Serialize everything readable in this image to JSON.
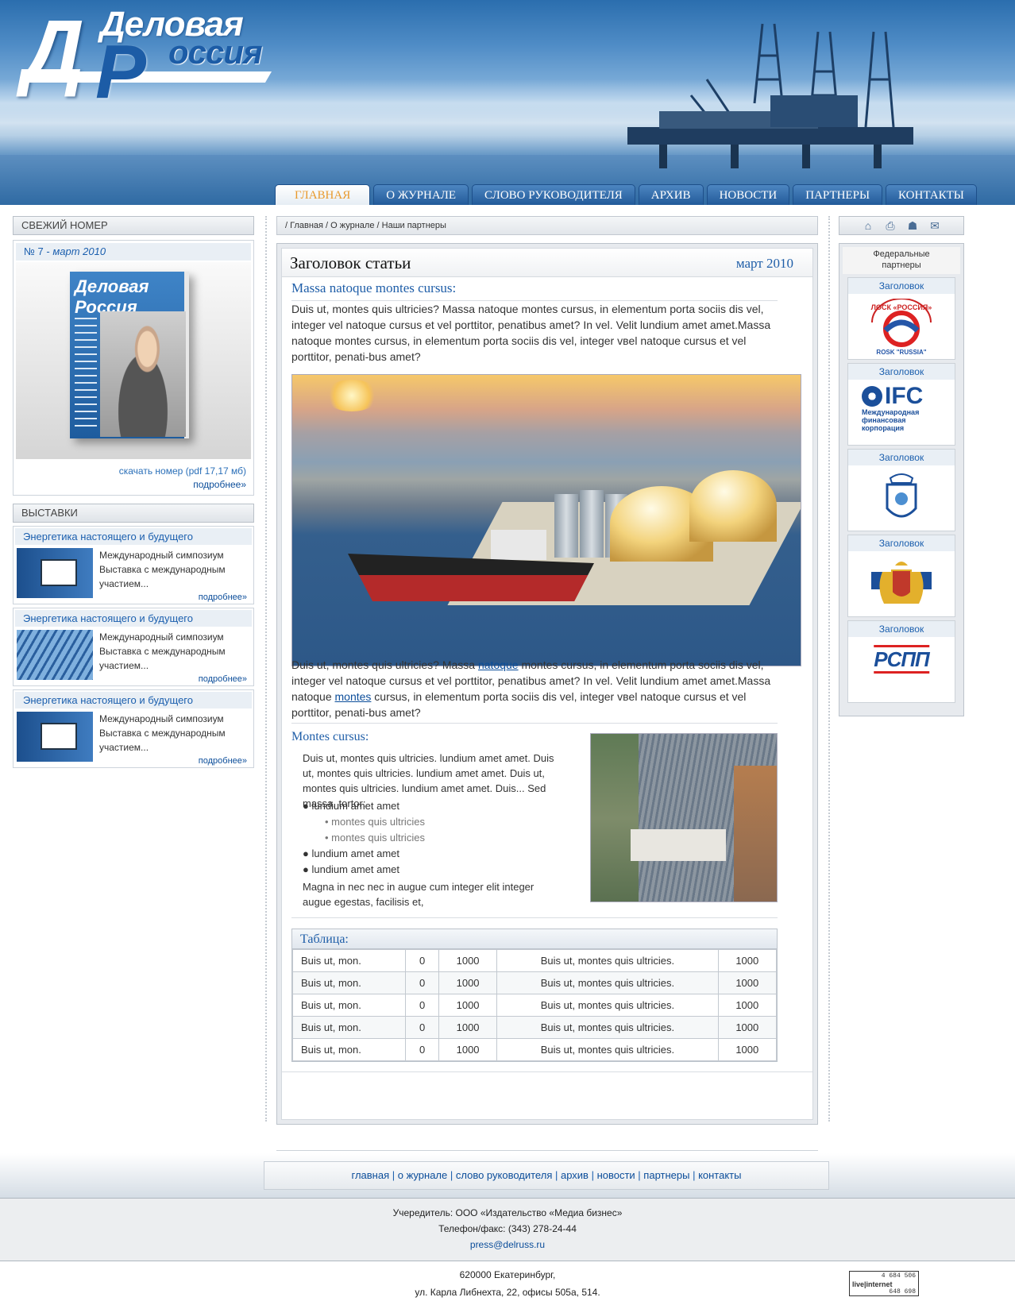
{
  "header": {
    "logo_line1": "Деловая",
    "logo_line2": "оссия",
    "logo_letter_d": "Д",
    "logo_letter_r": "Р"
  },
  "nav": {
    "tabs": [
      "ГЛАВНАЯ",
      "О ЖУРНАЛЕ",
      "СЛОВО РУКОВОДИТЕЛЯ",
      "АРХИВ",
      "НОВОСТИ",
      "ПАРТНЕРЫ",
      "КОНТАКТЫ"
    ],
    "active_index": 0
  },
  "left": {
    "issue_head": "СВЕЖИЙ НОМЕР",
    "issue_num": "№ 7 -",
    "issue_date": "март 2010",
    "cover_title": "Деловая Россия",
    "download": "скачать номер (pdf 17,17 мб)",
    "more": "подробнее»",
    "expo_head": "ВЫСТАВКИ",
    "expos": [
      {
        "title": "Энергетика настоящего и будущего",
        "line1": "Международный симпозиум",
        "line2": "Выставка с международным",
        "line3": "участием...",
        "more": "подробнее»",
        "thumb": "billboard"
      },
      {
        "title": "Энергетика настоящего и будущего",
        "line1": "Международный симпозиум",
        "line2": "Выставка с международным",
        "line3": "участием...",
        "more": "подробнее»",
        "thumb": "glass-building"
      },
      {
        "title": "Энергетика настоящего и будущего",
        "line1": "Международный симпозиум",
        "line2": "Выставка с международным",
        "line3": "участием...",
        "more": "подробнее»",
        "thumb": "billboard"
      }
    ]
  },
  "breadcrumb": "/ Главная / О журнале / Наши партнеры",
  "article": {
    "title": "Заголовок статьи",
    "date": "март 2010",
    "h1": "Massa natoque montes cursus:",
    "p1": "Duis ut, montes quis ultricies? Massa natoque montes cursus, in elementum porta sociis dis vel, integer vel natoque cursus et vel porttitor, penatibus amet? In vel. Velit lundium amet amet.Massa natoque montes cursus, in elementum porta sociis  dis vel, integer     vвel natoque cursus et vel porttitor, penati-bus amet?",
    "p2_a": "Duis ut, montes quis ultricies? Massa ",
    "p2_link1": "natoque",
    "p2_b": " montes cursus, in elementum porta sociis dis vel, integer vel natoque cursus et vel porttitor, penatibus amet? In vel. Velit lundium amet amet.Massa natoque ",
    "p2_link2": "montes",
    "p2_c": " cursus, in elementum porta sociis  dis vel, integer  vвel natoque cursus et vel porttitor, penati-bus amet?",
    "h2": "Montes cursus:",
    "p3": "Duis ut, montes quis ultricies. lundium amet amet. Duis ut, montes quis ultricies. lundium amet amet. Duis ut, montes quis ultricies. lundium amet amet. Duis... Sed massa, tortor:",
    "list": [
      "lundium amet amet",
      "montes quis ultricies",
      "montes quis ultricies",
      "lundium amet amet",
      "lundium amet amet"
    ],
    "p4": "Magna in nec nec in augue cum integer elit integer augue egestas, facilisis et,",
    "table_caption": "Таблица:",
    "table_rows": [
      [
        "Buis ut, mon.",
        "0",
        "1000",
        "Buis ut, montes quis ultricies.",
        "1000"
      ],
      [
        "Buis ut, mon.",
        "0",
        "1000",
        "Buis ut, montes quis ultricies.",
        "1000"
      ],
      [
        "Buis ut, mon.",
        "0",
        "1000",
        "Buis ut, montes quis ultricies.",
        "1000"
      ],
      [
        "Buis ut, mon.",
        "0",
        "1000",
        "Buis ut, montes quis ultricies.",
        "1000"
      ],
      [
        "Buis ut, mon.",
        "0",
        "1000",
        "Buis ut, montes quis ultricies.",
        "1000"
      ]
    ]
  },
  "right": {
    "tools": [
      "home-icon",
      "print-icon",
      "sitemap-icon",
      "mail-icon"
    ],
    "partners_title_1": "Федеральные",
    "partners_title_2": "партнеры",
    "partners": [
      {
        "title": "Заголовок",
        "logo_text": "ЛОСК «РОССИЯ»"
      },
      {
        "title": "Заголовок",
        "logo_text": "IFC",
        "logo_sub": "Международная финансовая корпорация"
      },
      {
        "title": "Заголовок",
        "logo_text": ""
      },
      {
        "title": "Заголовок",
        "logo_text": ""
      },
      {
        "title": "Заголовок",
        "logo_text": "РСПП"
      }
    ]
  },
  "footer": {
    "links": [
      "главная",
      "о журнале",
      "слово руководителя",
      "архив",
      "новости",
      "партнеры",
      "контакты"
    ],
    "founder": "Учередитель: ООО «Издательство «Медиа бизнес»",
    "phone": "Телефон/факс: (343) 278-24-44",
    "email": "press@delruss.ru",
    "addr1": "620000 Екатеринбург,",
    "addr2": "ул. Карла Либнехта, 22, офисы  505а, 514.",
    "counter_top": "4 684 506",
    "counter_bot": "648 698"
  }
}
